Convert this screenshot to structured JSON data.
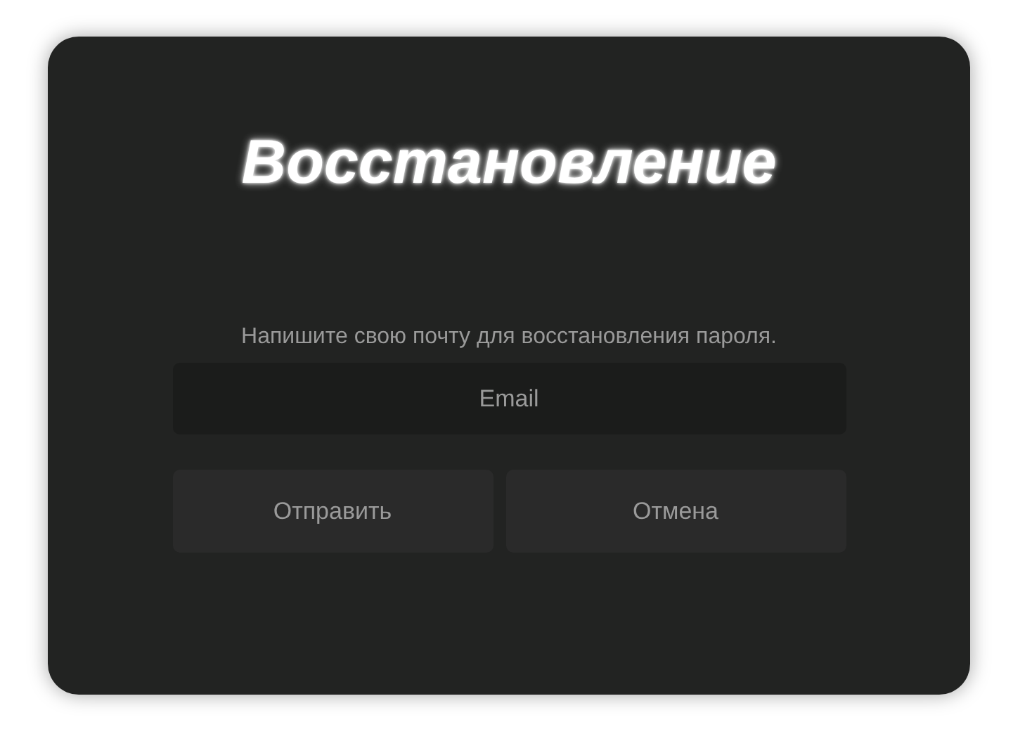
{
  "title": "Восстановление",
  "hint": "Напишите свою почту для восстановления пароля.",
  "email_field": {
    "placeholder": "Email"
  },
  "buttons": [
    {
      "label": "Отправить"
    },
    {
      "label": "Отмена"
    }
  ]
}
